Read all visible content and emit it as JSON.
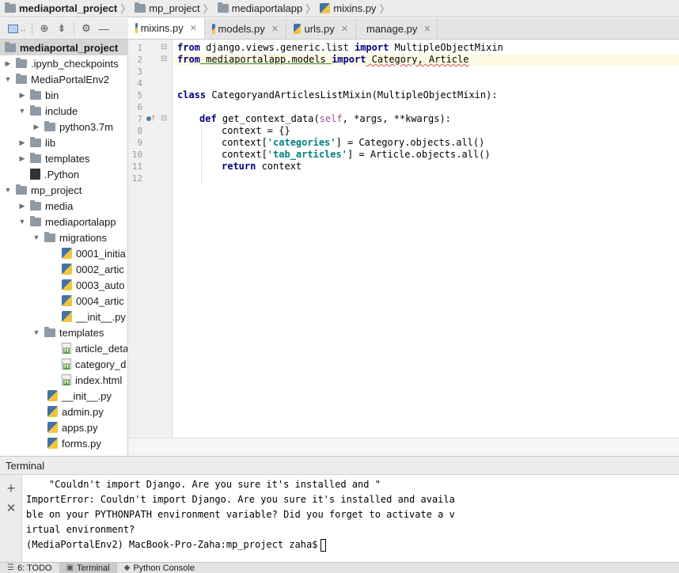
{
  "breadcrumb": {
    "items": [
      {
        "label": "mediaportal_project",
        "icon": "folder-icon"
      },
      {
        "label": "mp_project",
        "icon": "folder-icon"
      },
      {
        "label": "mediaportalapp",
        "icon": "folder-icon"
      },
      {
        "label": "mixins.py",
        "icon": "python-file-icon"
      }
    ]
  },
  "project_toolbar": {
    "view_selector": "..",
    "icons": [
      "project-view-icon",
      "locate-icon",
      "collapse-icon",
      "gear-icon",
      "hide-icon"
    ]
  },
  "tabs": [
    {
      "label": "mixins.py",
      "active": true
    },
    {
      "label": "models.py",
      "active": false
    },
    {
      "label": "urls.py",
      "active": false
    },
    {
      "label": "manage.py",
      "active": false
    }
  ],
  "tree": [
    {
      "label": "mediaportal_project",
      "type": "root"
    },
    {
      "label": ".ipynb_checkpoints",
      "type": "folder"
    },
    {
      "label": "MediaPortalEnv2",
      "type": "folder"
    },
    {
      "label": "bin",
      "type": "folder"
    },
    {
      "label": "include",
      "type": "folder"
    },
    {
      "label": "python3.7m",
      "type": "folder"
    },
    {
      "label": "lib",
      "type": "folder"
    },
    {
      "label": "templates",
      "type": "folder"
    },
    {
      "label": ".Python",
      "type": "binary"
    },
    {
      "label": "mp_project",
      "type": "folder"
    },
    {
      "label": "media",
      "type": "folder"
    },
    {
      "label": "mediaportalapp",
      "type": "folder"
    },
    {
      "label": "migrations",
      "type": "folder"
    },
    {
      "label": "0001_initia",
      "type": "python"
    },
    {
      "label": "0002_artic",
      "type": "python"
    },
    {
      "label": "0003_auto",
      "type": "python"
    },
    {
      "label": "0004_artic",
      "type": "python"
    },
    {
      "label": "__init__.py",
      "type": "python"
    },
    {
      "label": "templates",
      "type": "folder"
    },
    {
      "label": "article_deta",
      "type": "html"
    },
    {
      "label": "category_d",
      "type": "html"
    },
    {
      "label": "index.html",
      "type": "html"
    },
    {
      "label": "__init__.py",
      "type": "python"
    },
    {
      "label": "admin.py",
      "type": "python"
    },
    {
      "label": "apps.py",
      "type": "python"
    },
    {
      "label": "forms.py",
      "type": "python"
    }
  ],
  "editor": {
    "line_numbers": [
      "1",
      "2",
      "3",
      "4",
      "5",
      "6",
      "7",
      "8",
      "9",
      "10",
      "11",
      "12"
    ],
    "line1": {
      "kw1": "from",
      "mod": " django.views.generic.list ",
      "kw2": "import",
      "name": " MultipleObjectMixin"
    },
    "line2": {
      "kw1": "from",
      "mod": " mediaportalapp.models ",
      "kw2": "import",
      "name": " Category, Article"
    },
    "line5": {
      "kw": "class",
      "rest": " CategoryandArticlesListMixin(MultipleObjectMixin):"
    },
    "line7": {
      "kw": "def",
      "name": " get_context_data(",
      "self": "self",
      "rest": ", *args, **kwargs):"
    },
    "line8": "context = {}",
    "line9": {
      "pre": "context[",
      "str": "'categories'",
      "post": "] = Category.objects.all()"
    },
    "line10": {
      "pre": "context[",
      "str": "'tab_articles'",
      "post": "] = Article.objects.all()"
    },
    "line11": {
      "kw": "return",
      "rest": " context"
    }
  },
  "terminal": {
    "title": "Terminal",
    "lines": [
      "    \"Couldn't import Django. Are you sure it's installed and \"",
      "ImportError: Couldn't import Django. Are you sure it's installed and availa",
      "ble on your PYTHONPATH environment variable? Did you forget to activate a v",
      "irtual environment?",
      "(MediaPortalEnv2) MacBook-Pro-Zaha:mp_project zaha$"
    ]
  },
  "statusbar": {
    "todo": "6: TODO",
    "terminal": "Terminal",
    "python_console": "Python Console"
  }
}
